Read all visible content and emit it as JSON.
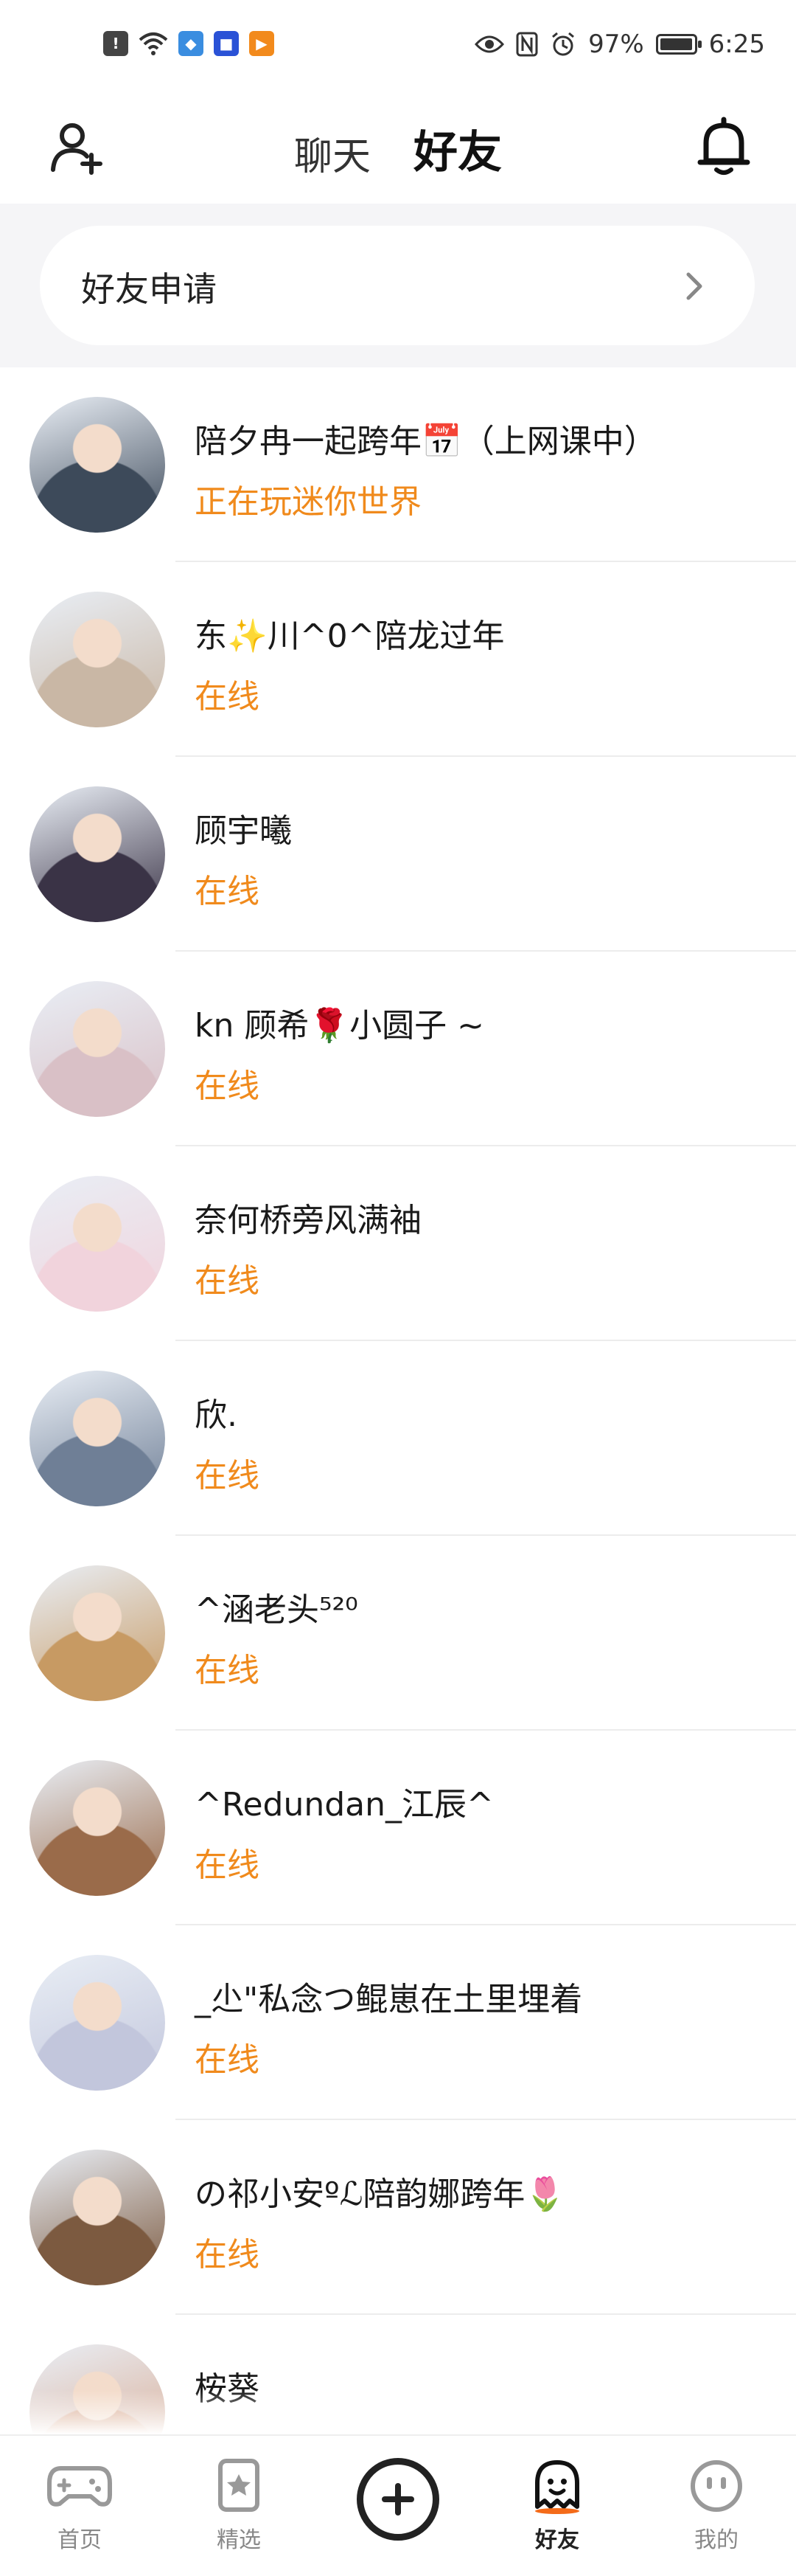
{
  "status_bar": {
    "battery_percent": "97%",
    "time": "6:25",
    "battery_level": 0.97
  },
  "header": {
    "tabs": [
      {
        "label": "聊天",
        "active": false
      },
      {
        "label": "好友",
        "active": true
      }
    ],
    "accent_color": "#f46b19"
  },
  "requests": {
    "label": "好友申请"
  },
  "friends": [
    {
      "name": "陪夕冉一起跨年📅（上网课中）",
      "status": "正在玩迷你世界",
      "avatar_color": "#3d4a5a"
    },
    {
      "name": "东✨川^0^陪龙过年",
      "status": "在线",
      "avatar_color": "#c9b7a5"
    },
    {
      "name": "顾宇曦",
      "status": "在线",
      "avatar_color": "#3a3346"
    },
    {
      "name": "kn 顾希🌹小圆子 ~",
      "status": "在线",
      "avatar_color": "#d9c0c6"
    },
    {
      "name": "奈何桥旁风满袖",
      "status": "在线",
      "avatar_color": "#f1d3dc"
    },
    {
      "name": "欣.",
      "status": "在线",
      "avatar_color": "#6f7f96"
    },
    {
      "name": "^涵老头⁵²⁰",
      "status": "在线",
      "avatar_color": "#c79a63"
    },
    {
      "name": "^Redundan_江辰^",
      "status": "在线",
      "avatar_color": "#9a6b4a"
    },
    {
      "name": "_尐\"私念つ鲲崽在土里埋着",
      "status": "在线",
      "avatar_color": "#c2c6dc"
    },
    {
      "name": "の祁小安ºℒ陪韵娜跨年🌷",
      "status": "在线",
      "avatar_color": "#7c5a40"
    },
    {
      "name": "桉葵",
      "status": "",
      "avatar_color": "#d7a58a"
    }
  ],
  "bottom_nav": {
    "items": [
      {
        "label": "首页",
        "icon": "gamepad-icon"
      },
      {
        "label": "精选",
        "icon": "star-card-icon"
      },
      {
        "label": "好友",
        "icon": "ghost-icon"
      },
      {
        "label": "我的",
        "icon": "face-icon"
      }
    ],
    "add_icon": "plus-circle-icon"
  }
}
